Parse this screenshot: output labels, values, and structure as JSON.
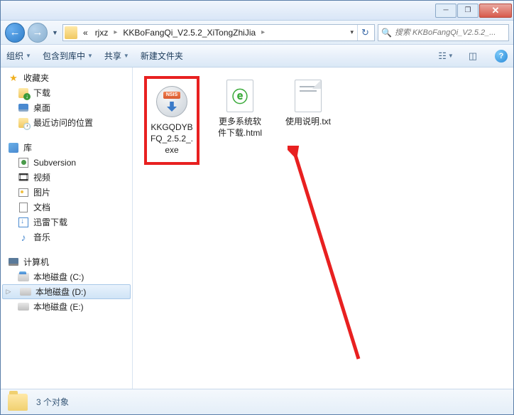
{
  "titlebar": {
    "min": "─",
    "max": "❐",
    "close": "✕"
  },
  "nav": {
    "back": "←",
    "fwd": "→",
    "dd": "▼"
  },
  "breadcrumb": {
    "prefix": "«",
    "segs": [
      "rjxz",
      "KKBoFangQi_V2.5.2_XiTongZhiJia"
    ],
    "caret": "▸",
    "end_caret": "▾",
    "refresh": "↻"
  },
  "search": {
    "placeholder": "搜索 KKBoFangQi_V2.5.2_..."
  },
  "toolbar": {
    "organize": "组织",
    "include": "包含到库中",
    "share": "共享",
    "newfolder": "新建文件夹",
    "dd": "▼"
  },
  "sidebar": {
    "fav": {
      "label": "收藏夹",
      "children": [
        {
          "id": "downloads",
          "label": "下载"
        },
        {
          "id": "desktop",
          "label": "桌面"
        },
        {
          "id": "recent",
          "label": "最近访问的位置"
        }
      ]
    },
    "lib": {
      "label": "库",
      "children": [
        {
          "id": "svn",
          "label": "Subversion"
        },
        {
          "id": "video",
          "label": "视频"
        },
        {
          "id": "pic",
          "label": "图片"
        },
        {
          "id": "doc",
          "label": "文档"
        },
        {
          "id": "xl",
          "label": "迅雷下载"
        },
        {
          "id": "music",
          "label": "音乐"
        }
      ]
    },
    "pc": {
      "label": "计算机",
      "children": [
        {
          "id": "c",
          "label": "本地磁盘 (C:)"
        },
        {
          "id": "d",
          "label": "本地磁盘 (D:)",
          "selected": true
        },
        {
          "id": "e",
          "label": "本地磁盘 (E:)"
        }
      ]
    }
  },
  "files": [
    {
      "id": "exe",
      "label": "KKGQDYBFQ_2.5.2_.exe",
      "highlighted": true
    },
    {
      "id": "html",
      "label": "更多系统软件下载.html"
    },
    {
      "id": "txt",
      "label": "使用说明.txt"
    }
  ],
  "exe_badge": "NSIS",
  "html_glyph": "ⓔ",
  "status": {
    "text": "3 个对象"
  }
}
